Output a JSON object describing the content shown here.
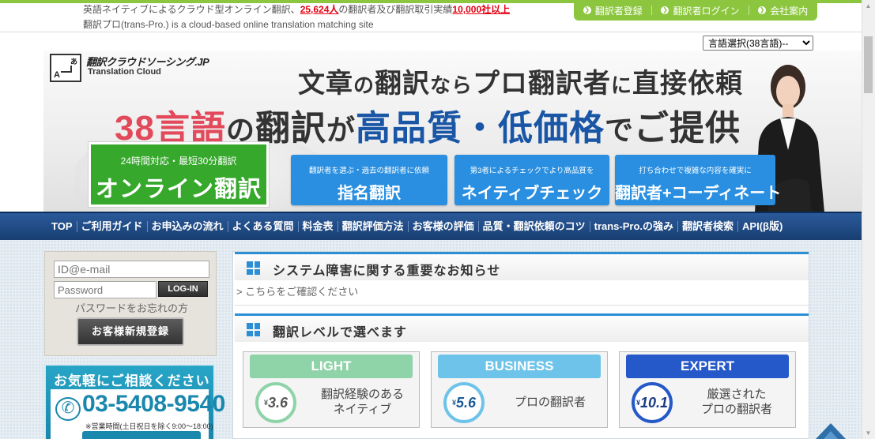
{
  "header": {
    "notice_pre": "英語ネイティブによるクラウド型オンライン翻訳、",
    "notice_count": "25,624人",
    "notice_mid": "の翻訳者及び翻訳取引実績",
    "notice_deals": "10,000社以上",
    "tagline": "翻訳プロ(trans-Pro.) is a cloud-based online translation matching site",
    "top_links": [
      "翻訳者登録",
      "翻訳者ログイン",
      "会社案内"
    ],
    "language_select": "言語選択(38言語)--"
  },
  "banner": {
    "logo_title": "翻訳クラウドソーシング.JP",
    "logo_subtitle": "Translation Cloud",
    "logo_glyph_top": "あ",
    "logo_glyph_bottom": "A",
    "headline1": [
      "文章",
      "の",
      "翻訳",
      "なら",
      "プロ翻訳者",
      "に",
      "直接依頼"
    ],
    "headline2": [
      "38言語",
      "の",
      "翻訳",
      "が",
      "高品質・低価格",
      "で",
      "ご提供"
    ],
    "online_button": {
      "sub": "24時間対応・最短30分翻訳",
      "main": "オンライン翻訳"
    },
    "service_buttons": [
      {
        "sub": "翻訳者を選ぶ・過去の翻訳者に依頼",
        "main": "指名翻訳"
      },
      {
        "sub": "第3者によるチェックでより高品質を",
        "main": "ネイティブチェック"
      },
      {
        "sub": "打ち合わせで複雑な内容を確実に",
        "main": "翻訳者+コーディネート"
      }
    ]
  },
  "nav": [
    "TOP",
    "ご利用ガイド",
    "お申込みの流れ",
    "よくある質問",
    "料金表",
    "翻訳評価方法",
    "お客様の評価",
    "品質・翻訳依頼のコツ",
    "trans-Pro.の強み",
    "翻訳者検索",
    "API(β版)"
  ],
  "login": {
    "id_placeholder": "ID@e-mail",
    "password_placeholder": "Password",
    "login_button": "LOG-IN",
    "forgot": "パスワードをお忘れの方",
    "register_button": "お客様新規登録"
  },
  "contact": {
    "title": "お気軽にご相談ください",
    "phone": "03-5408-9540",
    "hours": "※営業時間(土日祝日を除く9:00～18:00)"
  },
  "main": {
    "notice_title": "システム障害に関する重要なお知らせ",
    "notice_link": "> こちらをご確認ください",
    "levels_title": "翻訳レベルで選べます",
    "levels": [
      {
        "name": "LIGHT",
        "price": "3.6",
        "desc": [
          "翻訳経験のある",
          "ネイティブ"
        ],
        "color": "#8fd3a8"
      },
      {
        "name": "BUSINESS",
        "price": "5.6",
        "desc": [
          "プロの翻訳者"
        ],
        "color": "#6ec3ea"
      },
      {
        "name": "EXPERT",
        "price": "10.1",
        "desc": [
          "厳選された",
          "プロの翻訳者"
        ],
        "color": "#2559c9"
      }
    ],
    "yen": "¥"
  },
  "colors": {
    "green": "#8cc63f",
    "nav_blue": "#1d4a86",
    "accent_blue": "#2c8fd6",
    "red": "#e60012"
  }
}
